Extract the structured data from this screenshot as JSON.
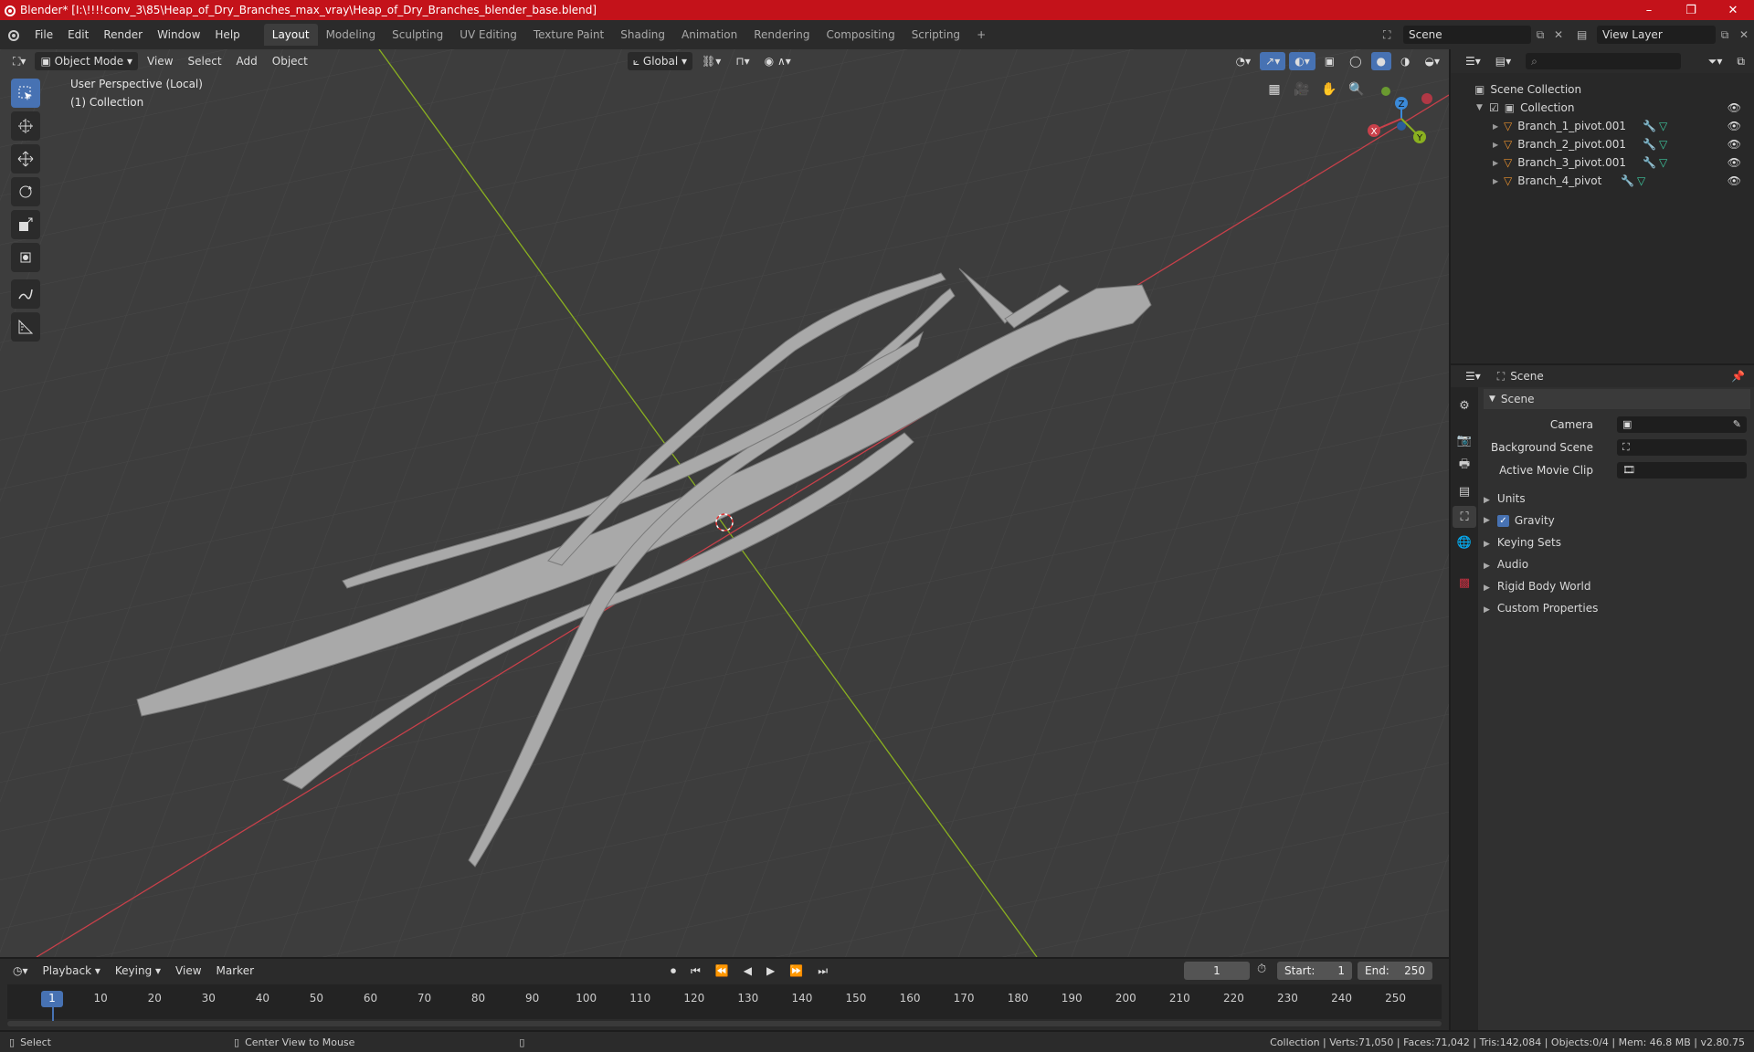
{
  "title_bar": {
    "text": "Blender* [I:\\!!!!conv_3\\85\\Heap_of_Dry_Branches_max_vray\\Heap_of_Dry_Branches_blender_base.blend]",
    "minimize": "–",
    "maximize": "❐",
    "close": "✕"
  },
  "menu": [
    "File",
    "Edit",
    "Render",
    "Window",
    "Help"
  ],
  "workspaces": [
    "Layout",
    "Modeling",
    "Sculpting",
    "UV Editing",
    "Texture Paint",
    "Shading",
    "Animation",
    "Rendering",
    "Compositing",
    "Scripting",
    "+"
  ],
  "scene_selector": "Scene",
  "view_layer": "View Layer",
  "viewport_header": {
    "mode": "Object Mode",
    "view": "View",
    "select": "Select",
    "add": "Add",
    "object": "Object",
    "orientation": "Global"
  },
  "viewport_overlay": {
    "line1": "User Perspective (Local)",
    "line2": "(1) Collection"
  },
  "gizmo": {
    "z": "Z",
    "x": "X",
    "y": "Y"
  },
  "outliner": {
    "scene_collection": "Scene Collection",
    "collection": "Collection",
    "objects": [
      "Branch_1_pivot.001",
      "Branch_2_pivot.001",
      "Branch_3_pivot.001",
      "Branch_4_pivot"
    ]
  },
  "properties": {
    "header": "Scene",
    "panel_title": "Scene",
    "camera_label": "Camera",
    "background_scene_label": "Background Scene",
    "active_movie_clip_label": "Active Movie Clip",
    "sections": [
      "Units",
      "Gravity",
      "Keying Sets",
      "Audio",
      "Rigid Body World",
      "Custom Properties"
    ],
    "gravity_checked": true
  },
  "timeline": {
    "menus": [
      "Playback",
      "Keying",
      "View",
      "Marker"
    ],
    "current_frame": "1",
    "start_label": "Start:",
    "start": "1",
    "end_label": "End:",
    "end": "250",
    "ticks": [
      "1",
      "10",
      "20",
      "30",
      "40",
      "50",
      "60",
      "70",
      "80",
      "90",
      "100",
      "110",
      "120",
      "130",
      "140",
      "150",
      "160",
      "170",
      "180",
      "190",
      "200",
      "210",
      "220",
      "230",
      "240",
      "250"
    ]
  },
  "status_bar": {
    "select": "Select",
    "center": "Center View to Mouse",
    "stats": "Collection | Verts:71,050 | Faces:71,042 | Tris:142,084 | Objects:0/4 | Mem: 46.8 MB | v2.80.75"
  },
  "colors": {
    "title_red": "#c4121a",
    "accent_blue": "#4772b3",
    "x_axis": "#c8404a",
    "y_axis": "#8ab020",
    "z_axis": "#3b8ad8"
  }
}
